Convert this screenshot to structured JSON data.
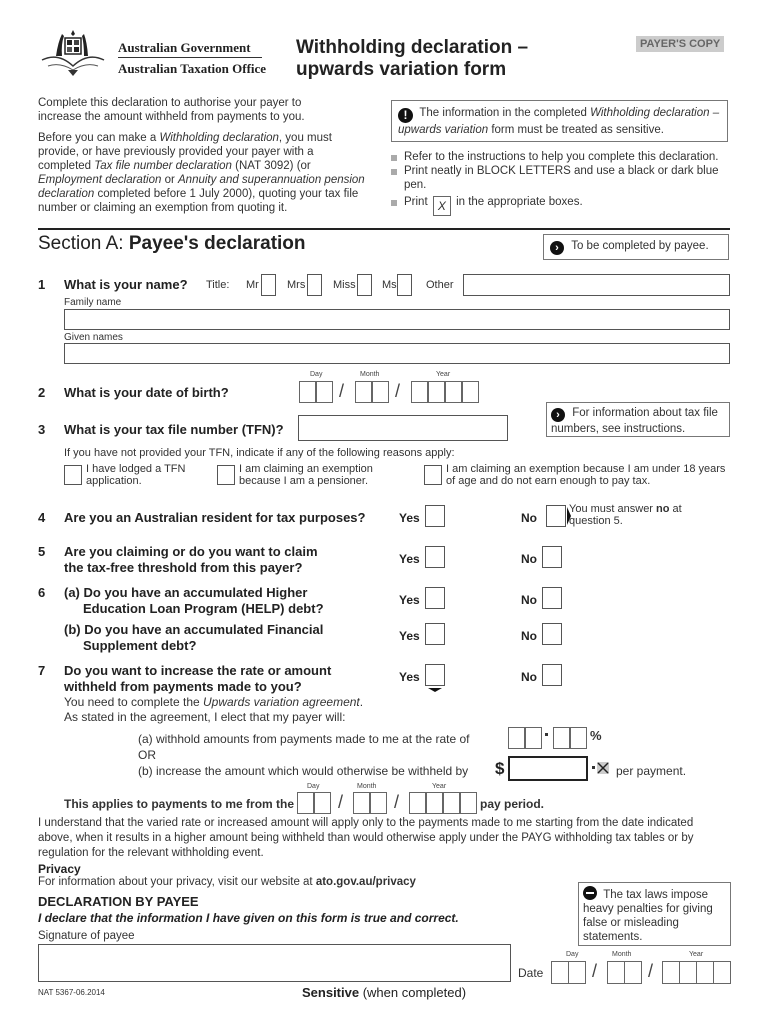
{
  "header": {
    "gov_line1": "Australian Government",
    "gov_line2": "Australian Taxation Office",
    "title_line1": "Withholding declaration –",
    "title_line2": "upwards variation form",
    "copy_badge": "PAYER'S COPY"
  },
  "intro": {
    "para1": "Complete this declaration to authorise your payer to increase the amount withheld from payments to you.",
    "para2_parts": [
      "Before you can make a ",
      "Withholding declaration",
      ", you must provide, or have previously provided your payer with a completed ",
      "Tax file number declaration",
      " (NAT 3092) (or ",
      "Employment declaration",
      " or ",
      "Annuity and superannuation pension declaration",
      " completed before 1 July 2000), quoting your tax file number or claiming an exemption from quoting it."
    ]
  },
  "notice": {
    "icon": "exclamation-icon",
    "text_parts": [
      "The information in the completed ",
      "Withholding declaration – upwards variation",
      " form must be treated as sensitive."
    ]
  },
  "instructions": [
    "Refer to the instructions to help you complete this declaration.",
    "Print neatly in BLOCK LETTERS and use a black or dark blue pen.",
    "Print",
    "in the appropriate boxes."
  ],
  "instructions_mark": "X",
  "section_a": {
    "prefix": "Section A: ",
    "title": "Payee's declaration",
    "note": "To be completed by payee."
  },
  "q1": {
    "num": "1",
    "text": "What is your name?",
    "title_label": "Title:",
    "titles": [
      "Mr",
      "Mrs",
      "Miss",
      "Ms",
      "Other"
    ],
    "family_label": "Family name",
    "given_label": "Given names"
  },
  "date_labels": {
    "day": "Day",
    "month": "Month",
    "year": "Year",
    "sep": "/"
  },
  "q2": {
    "num": "2",
    "text": "What is your date of birth?"
  },
  "q3": {
    "num": "3",
    "text": "What is your tax file number (TFN)?",
    "info": "For information about tax file numbers, see instructions.",
    "reasons_intro": "If you have not provided your TFN, indicate if any of the following reasons apply:",
    "reasons": [
      "I have lodged a TFN application.",
      "I am claiming an exemption because I am a pensioner.",
      "I am claiming an exemption because I am under 18 years of age and do not earn enough to pay tax."
    ]
  },
  "yes_label": "Yes",
  "no_label": "No",
  "q4": {
    "num": "4",
    "text": "Are you an Australian resident for tax purposes?",
    "note_pre": "You must answer ",
    "note_bold": "no",
    "note_post": " at question 5."
  },
  "q5": {
    "num": "5",
    "line1": "Are you claiming or do you want to claim",
    "line2": "the tax-free threshold from this payer?"
  },
  "q6": {
    "num": "6",
    "a_line1": "(a) Do you have an accumulated Higher",
    "a_line2": "Education Loan Program (HELP) debt?",
    "b_line1": "(b) Do you have an accumulated Financial",
    "b_line2": "Supplement debt?"
  },
  "q7": {
    "num": "7",
    "line1": "Do you want to increase the rate or amount",
    "line2": "withheld from payments made to you?",
    "need_pre": "You need to complete the ",
    "need_em": "Upwards variation agreement",
    "need_post": ".",
    "elect": "As stated in the agreement, I elect that my payer will:",
    "opt_a": "(a) withhold amounts from payments made to me at the rate of",
    "percent": "%",
    "or": "OR",
    "opt_b": "(b) increase the amount which would otherwise be withheld by",
    "dollar": "$",
    "per_payment": "per payment.",
    "applies": "This applies to payments to me from the",
    "pay_period": "pay period."
  },
  "understand": "I understand that the varied rate or increased amount will apply only to the payments made to me starting from the date indicated above, when it results in a higher amount being withheld than would otherwise apply under the PAYG withholding tax tables or by regulation for the relevant withholding event.",
  "privacy": {
    "heading": "Privacy",
    "text": "For information about your privacy, visit our website at ",
    "link": "ato.gov.au/privacy"
  },
  "declaration": {
    "heading": "DECLARATION BY PAYEE",
    "statement": "I declare that the information I have given on this form is true and correct.",
    "signature_label": "Signature of payee",
    "date_label": "Date",
    "penalty": "The tax laws impose heavy penalties for giving false or misleading statements."
  },
  "footer": {
    "code": "NAT 5367-06.2014",
    "sensitive_bold": "Sensitive",
    "sensitive_rest": " (when completed)"
  }
}
